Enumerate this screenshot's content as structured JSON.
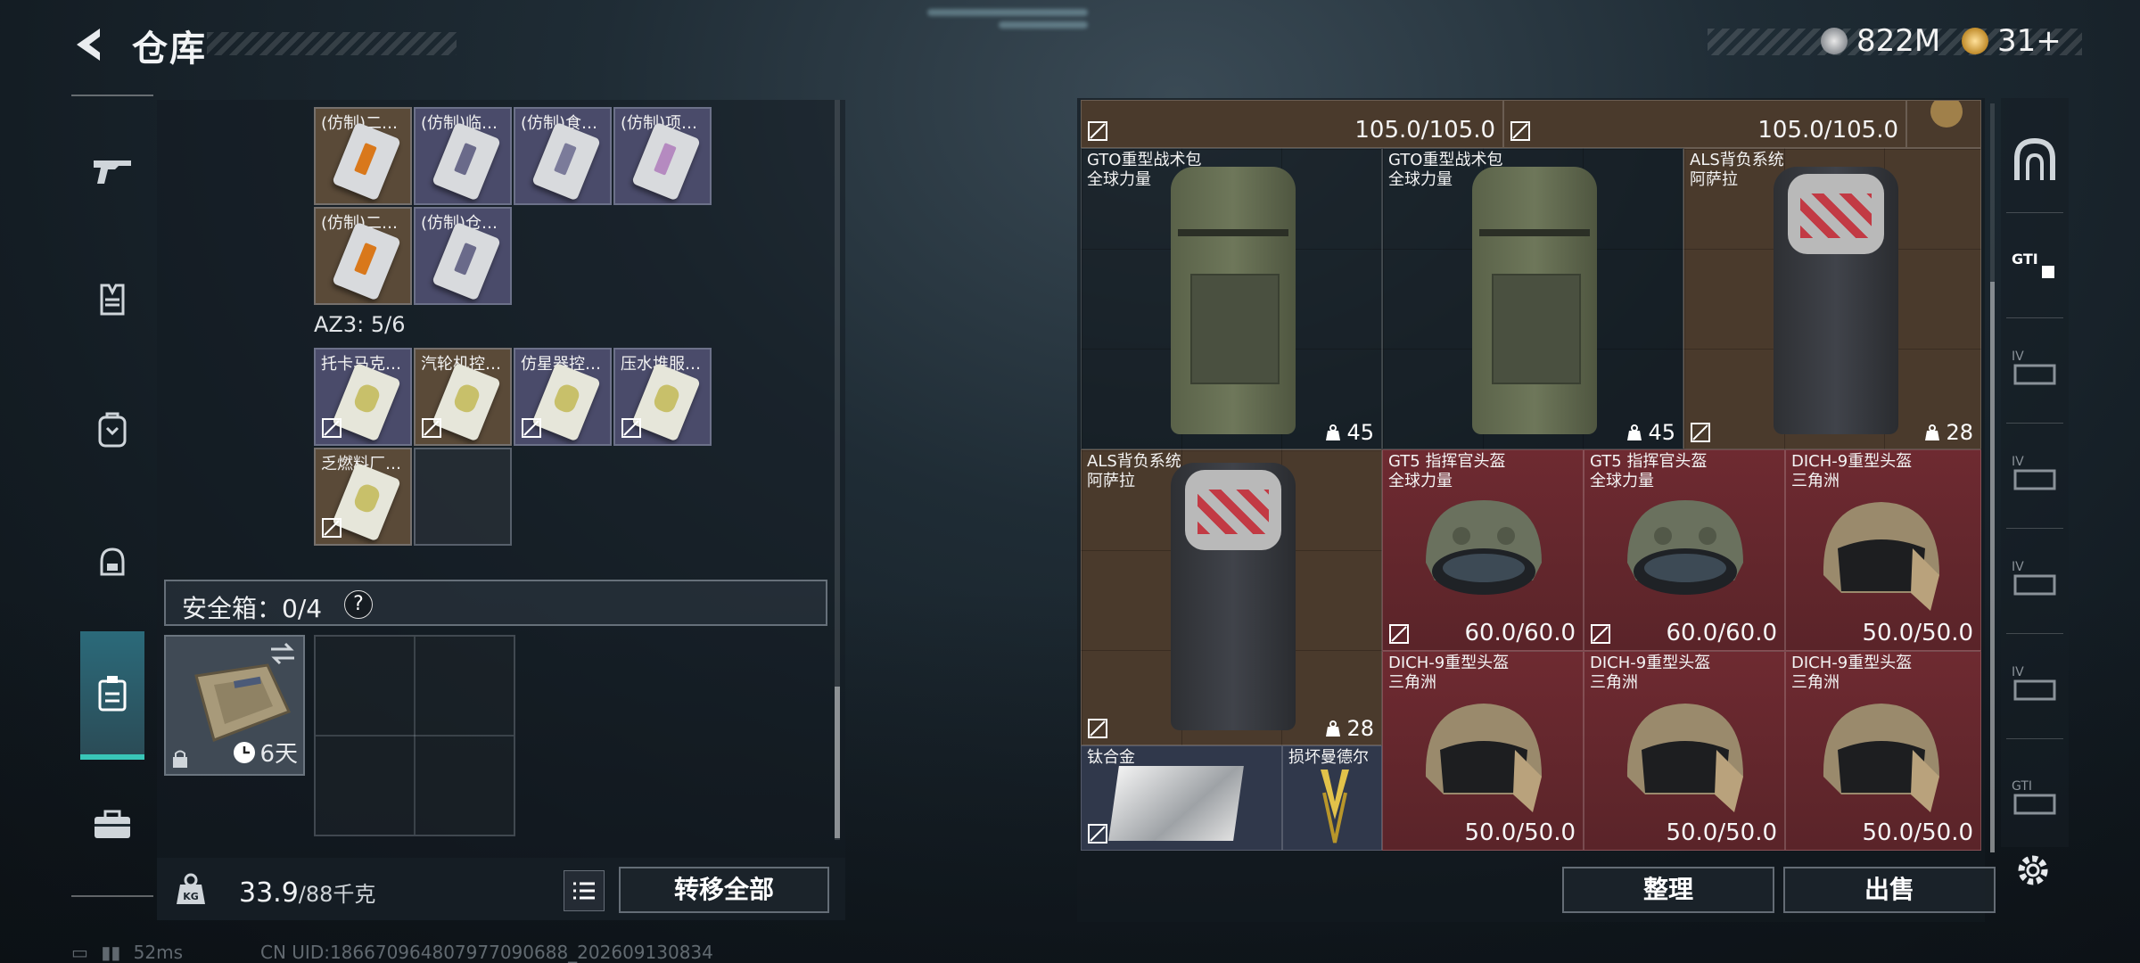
{
  "header": {
    "title": "仓库",
    "currency_money": "822M",
    "currency_coin": "31+"
  },
  "left_nav": [
    "gun-icon",
    "armor-vest-icon",
    "backpack-icon",
    "helmet-bag-icon",
    "safe-box-icon",
    "toolbox-icon"
  ],
  "container_items": [
    {
      "label": "(仿制)二…",
      "bg": "brown",
      "stripe": "#d9781b"
    },
    {
      "label": "(仿制)临…",
      "bg": "purple",
      "stripe": "#6a6a8a"
    },
    {
      "label": "(仿制)食…",
      "bg": "purple",
      "stripe": "#7b7b9a"
    },
    {
      "label": "(仿制)项…",
      "bg": "purple",
      "stripe": "#b58ac0"
    },
    {
      "label": "(仿制)二…",
      "bg": "brown",
      "stripe": "#d9781b"
    },
    {
      "label": "(仿制)仓…",
      "bg": "purple",
      "stripe": "#6a6a8a"
    }
  ],
  "az3": {
    "label": "AZ3: 5/6"
  },
  "az3_items": [
    {
      "label": "托卡马克…",
      "bg": "purple"
    },
    {
      "label": "汽轮机控…",
      "bg": "brown"
    },
    {
      "label": "仿星器控…",
      "bg": "purple"
    },
    {
      "label": "压水堆服…",
      "bg": "purple"
    },
    {
      "label": "乏燃料厂…",
      "bg": "brown"
    }
  ],
  "safe_box": {
    "label": "安全箱：0/4",
    "help": "?",
    "timer": "6天"
  },
  "footer": {
    "weight_value": "33.9",
    "weight_unit": "/88千克",
    "transfer_all": "转移全部"
  },
  "status": {
    "ping": "52ms",
    "uid": "CN UID:18667096480797709068​8_202609130834"
  },
  "stash": {
    "top_values": [
      "105.0/105.0",
      "105.0/105.0"
    ],
    "items": [
      {
        "name": "GTO重型战术包",
        "sub": "全球力量",
        "value": "45",
        "kind": "pack-green"
      },
      {
        "name": "GTO重型战术包",
        "sub": "全球力量",
        "value": "45",
        "kind": "pack-green"
      },
      {
        "name": "ALS背负系统",
        "sub": "阿萨拉",
        "value": "28",
        "kind": "pack-red"
      },
      {
        "name": "ALS背负系统",
        "sub": "阿萨拉",
        "value": "28",
        "kind": "pack-red"
      },
      {
        "name": "GT5 指挥官头盔",
        "sub": "全球力量",
        "value": "60.0/60.0",
        "kind": "helmet-green"
      },
      {
        "name": "GT5 指挥官头盔",
        "sub": "全球力量",
        "value": "60.0/60.0",
        "kind": "helmet-green"
      },
      {
        "name": "DICH-9重型头盔",
        "sub": "三角洲",
        "value": "50.0/50.0",
        "kind": "helmet-tan"
      },
      {
        "name": "DICH-9重型头盔",
        "sub": "三角洲",
        "value": "50.0/50.0",
        "kind": "helmet-tan"
      },
      {
        "name": "DICH-9重型头盔",
        "sub": "三角洲",
        "value": "50.0/50.0",
        "kind": "helmet-tan"
      },
      {
        "name": "DICH-9重型头盔",
        "sub": "三角洲",
        "value": "50.0/50.0",
        "kind": "helmet-tan"
      },
      {
        "name": "钛合金",
        "sub": "",
        "value": "",
        "kind": "titanium"
      },
      {
        "name": "损坏曼德尔",
        "sub": "",
        "value": "",
        "kind": "mandel"
      }
    ]
  },
  "buttons": {
    "sort": "整理",
    "sell": "出售"
  },
  "colors": {
    "accent": "#39c6b8",
    "red_slot": "#6e2a31",
    "blue_slot": "#30384b"
  }
}
